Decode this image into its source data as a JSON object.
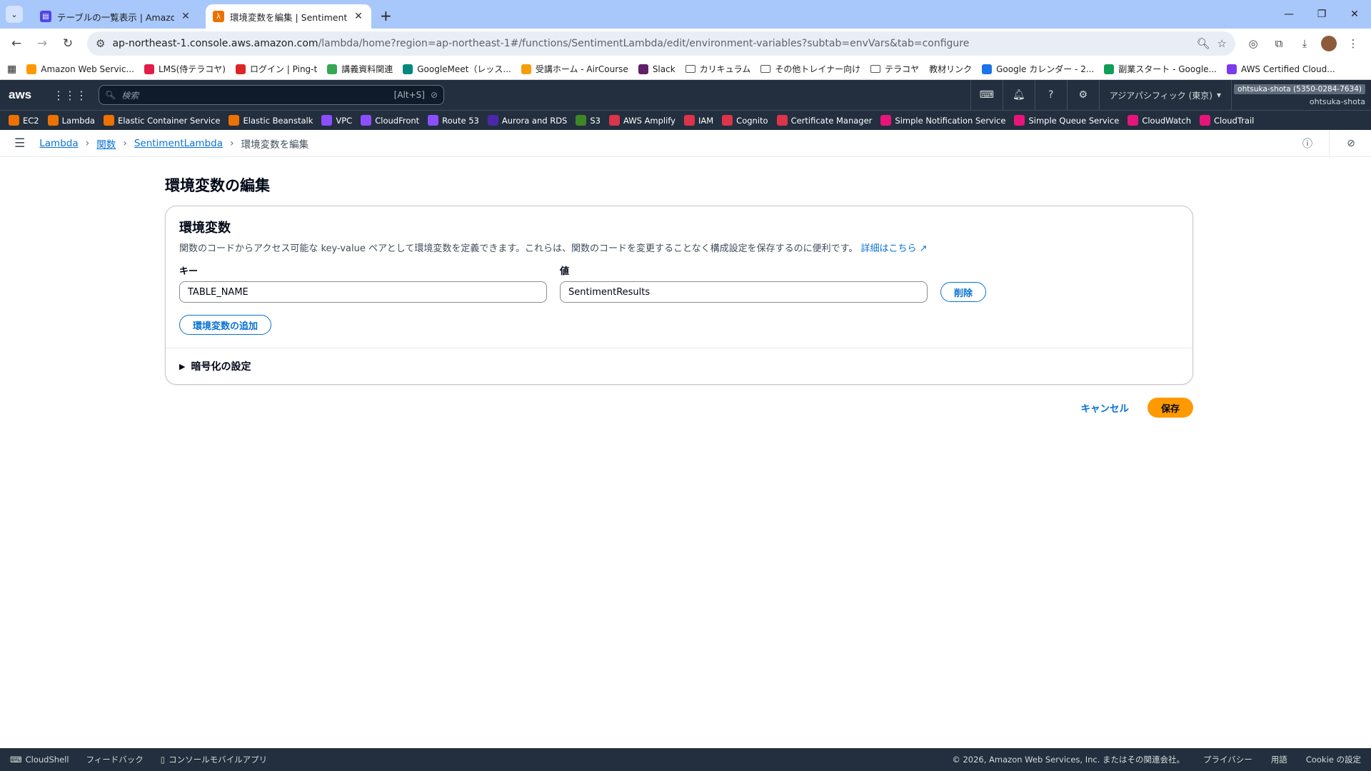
{
  "browser": {
    "tabs": [
      {
        "title": "テーブルの一覧表示 | Amazon Dy",
        "color": "#4f46e5"
      },
      {
        "title": "環境変数を編集 | SentimentLam",
        "color": "#ed7100"
      }
    ],
    "url_host": "ap-northeast-1.console.aws.amazon.com",
    "url_path": "/lambda/home?region=ap-northeast-1#/functions/SentimentLambda/edit/environment-variables?subtab=envVars&tab=configure",
    "bookmarks": [
      {
        "label": "Amazon Web Servic...",
        "color": "#ff9900"
      },
      {
        "label": "LMS(侍テラコヤ)",
        "color": "#e11d48"
      },
      {
        "label": "ログイン | Ping-t",
        "color": "#dc2626"
      },
      {
        "label": "講義資料関連",
        "color": "#34a853"
      },
      {
        "label": "GoogleMeet（レッス...",
        "color": "#00897b"
      },
      {
        "label": "受講ホーム - AirCourse",
        "color": "#f59e0b"
      },
      {
        "label": "Slack",
        "color": "#611f69"
      },
      {
        "label": "カリキュラム",
        "folder": true
      },
      {
        "label": "その他トレイナー向け",
        "folder": true
      },
      {
        "label": "テラコヤ",
        "folder": true
      },
      {
        "label": "教材リンク",
        "color": ""
      },
      {
        "label": "Google カレンダー - 2...",
        "color": "#1a73e8"
      },
      {
        "label": "副業スタート - Google...",
        "color": "#0f9d58"
      },
      {
        "label": "AWS Certified Cloud...",
        "color": "#7c3aed"
      }
    ]
  },
  "aws": {
    "logo": "aws",
    "search_placeholder": "検索",
    "search_shortcut": "[Alt+S]",
    "region": "アジアパシフィック (東京)",
    "account_badge": "ohtsuka-shota (5350-0284-7634)",
    "account_name": "ohtsuka-shota",
    "services": [
      {
        "label": "EC2",
        "color": "#ed7100"
      },
      {
        "label": "Lambda",
        "color": "#ed7100"
      },
      {
        "label": "Elastic Container Service",
        "color": "#ed7100"
      },
      {
        "label": "Elastic Beanstalk",
        "color": "#ed7100"
      },
      {
        "label": "VPC",
        "color": "#8c4fff"
      },
      {
        "label": "CloudFront",
        "color": "#8c4fff"
      },
      {
        "label": "Route 53",
        "color": "#8c4fff"
      },
      {
        "label": "Aurora and RDS",
        "color": "#4d27aa"
      },
      {
        "label": "S3",
        "color": "#3f8624"
      },
      {
        "label": "AWS Amplify",
        "color": "#dd344c"
      },
      {
        "label": "IAM",
        "color": "#dd344c"
      },
      {
        "label": "Cognito",
        "color": "#dd344c"
      },
      {
        "label": "Certificate Manager",
        "color": "#dd344c"
      },
      {
        "label": "Simple Notification Service",
        "color": "#e7157b"
      },
      {
        "label": "Simple Queue Service",
        "color": "#e7157b"
      },
      {
        "label": "CloudWatch",
        "color": "#e7157b"
      },
      {
        "label": "CloudTrail",
        "color": "#e7157b"
      }
    ]
  },
  "breadcrumb": {
    "items": [
      "Lambda",
      "関数",
      "SentimentLambda"
    ],
    "current": "環境変数を編集"
  },
  "page": {
    "title": "環境変数の編集",
    "panel_title": "環境変数",
    "panel_desc": "関数のコードからアクセス可能な key-value ペアとして環境変数を定義できます。これらは、関数のコードを変更することなく構成設定を保存するのに便利です。",
    "learn_more": "詳細はこちら",
    "key_label": "キー",
    "value_label": "値",
    "env_key": "TABLE_NAME",
    "env_value": "SentimentResults",
    "remove_label": "削除",
    "add_label": "環境変数の追加",
    "encryption_label": "暗号化の設定",
    "cancel_label": "キャンセル",
    "save_label": "保存"
  },
  "footer": {
    "cloudshell": "CloudShell",
    "feedback": "フィードバック",
    "mobile": "コンソールモバイルアプリ",
    "copyright": "© 2026, Amazon Web Services, Inc. またはその関連会社。",
    "privacy": "プライバシー",
    "terms": "用語",
    "cookie": "Cookie の設定"
  }
}
